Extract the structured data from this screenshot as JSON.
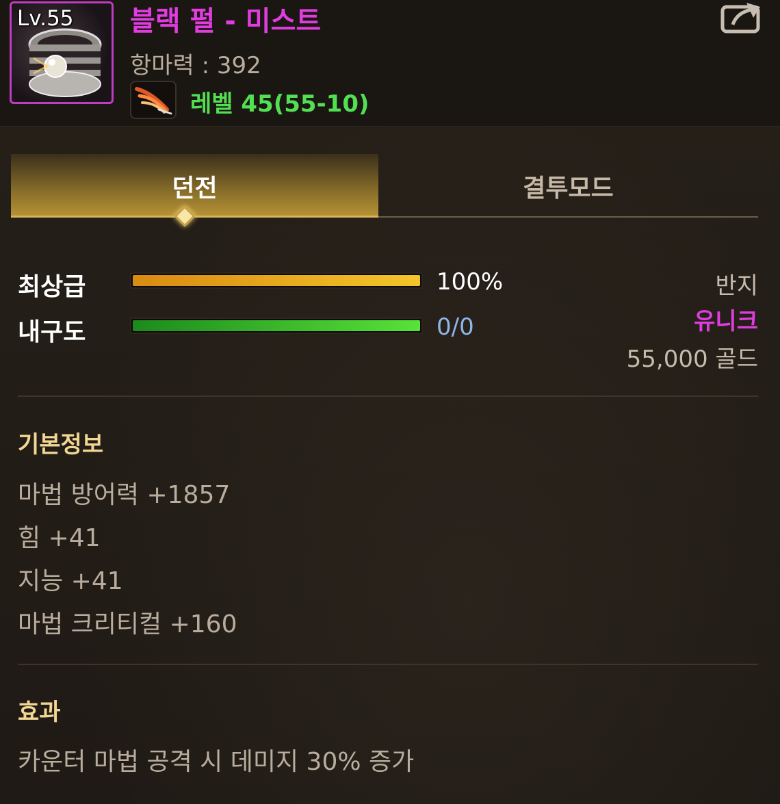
{
  "item": {
    "level_badge": "Lv.55",
    "name": "블랙 펄 - 미스트",
    "stat_line": "항마력 : 392",
    "level_requirement": "레벨 45(55-10)",
    "name_color": "#e03ce0",
    "icon": "pearl-ring-icon"
  },
  "tabs": [
    {
      "label": "던전",
      "active": true
    },
    {
      "label": "결투모드",
      "active": false
    }
  ],
  "grade": {
    "label": "최상급",
    "value_text": "100%",
    "fill_percent": 100
  },
  "durability": {
    "label": "내구도",
    "value_text": "0/0",
    "fill_percent": 100
  },
  "item_type": "반지",
  "rarity": "유니크",
  "price": "55,000 골드",
  "basic_info": {
    "title": "기본정보",
    "lines": [
      "마법 방어력 +1857",
      "힘 +41",
      "지능 +41",
      "마법 크리티컬 +160"
    ]
  },
  "effect": {
    "title": "효과",
    "lines": [
      "카운터 마법 공격 시 데미지 30% 증가"
    ]
  },
  "colors": {
    "unique": "#e03ce0",
    "requirement": "#52e052",
    "section_title": "#f2d693",
    "durability_text": "#8fb6e8"
  }
}
